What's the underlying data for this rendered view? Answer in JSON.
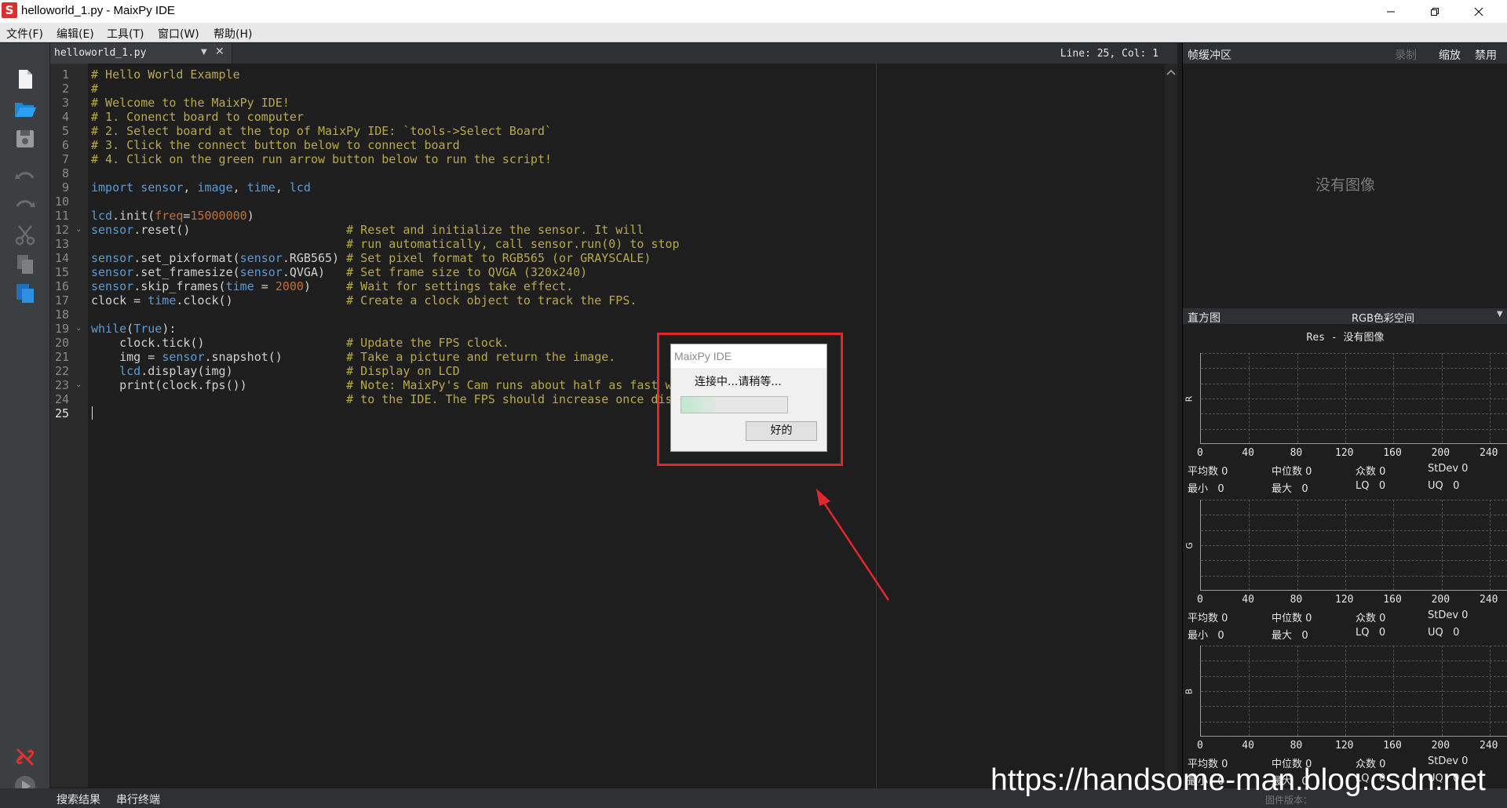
{
  "window": {
    "title": "helloworld_1.py - MaixPy IDE",
    "app_icon": "S"
  },
  "menu": [
    "文件(F)",
    "编辑(E)",
    "工具(T)",
    "窗口(W)",
    "帮助(H)"
  ],
  "editor": {
    "tab_name": "helloworld_1.py",
    "cursor_status": "Line: 25, Col: 1",
    "code_lines": [
      "# Hello World Example",
      "#",
      "# Welcome to the MaixPy IDE!",
      "# 1. Conenct board to computer",
      "# 2. Select board at the top of MaixPy IDE: `tools->Select Board`",
      "# 3. Click the connect button below to connect board",
      "# 4. Click on the green run arrow button below to run the script!",
      "",
      "import sensor, image, time, lcd",
      "",
      "lcd.init(freq=15000000)",
      "sensor.reset()                      # Reset and initialize the sensor. It will",
      "                                    # run automatically, call sensor.run(0) to stop",
      "sensor.set_pixformat(sensor.RGB565) # Set pixel format to RGB565 (or GRAYSCALE)",
      "sensor.set_framesize(sensor.QVGA)   # Set frame size to QVGA (320x240)",
      "sensor.skip_frames(time = 2000)     # Wait for settings take effect.",
      "clock = time.clock()                # Create a clock object to track the FPS.",
      "",
      "while(True):",
      "    clock.tick()                    # Update the FPS clock.",
      "    img = sensor.snapshot()         # Take a picture and return the image.",
      "    lcd.display(img)                # Display on LCD",
      "    print(clock.fps())              # Note: MaixPy's Cam runs about half as fast when connected",
      "                                    # to the IDE. The FPS should increase once disconnected.",
      ""
    ]
  },
  "framebuffer": {
    "title": "帧缓冲区",
    "record": "录制",
    "zoom": "缩放",
    "disable": "禁用",
    "no_image": "没有图像"
  },
  "histogram": {
    "title": "直方图",
    "color_space": "RGB色彩空间",
    "res_label": "Res - 没有图像",
    "x_ticks": [
      "0",
      "40",
      "80",
      "120",
      "160",
      "200",
      "240"
    ],
    "channels": [
      {
        "name": "R",
        "stats": {
          "mean": "平均数 0",
          "median": "中位数 0",
          "mode": "众数 0",
          "stdev": "StDev 0",
          "min": "最小   0",
          "max": "最大   0",
          "lq": "LQ   0",
          "uq": "UQ   0"
        }
      },
      {
        "name": "G",
        "stats": {
          "mean": "平均数 0",
          "median": "中位数 0",
          "mode": "众数 0",
          "stdev": "StDev 0",
          "min": "最小   0",
          "max": "最大   0",
          "lq": "LQ   0",
          "uq": "UQ   0"
        }
      },
      {
        "name": "B",
        "stats": {
          "mean": "平均数 0",
          "median": "中位数 0",
          "mode": "众数 0",
          "stdev": "StDev 0",
          "min": "最小   0",
          "max": "最大   0",
          "lq": "LQ   0",
          "uq": "UQ   0"
        }
      }
    ]
  },
  "bottom": {
    "search_results": "搜索结果",
    "serial_terminal": "串行终端",
    "firmware": "固件版本："
  },
  "dialog": {
    "title": "MaixPy IDE",
    "message": "连接中...请稍等...",
    "ok": "好的",
    "progress": 0.35
  },
  "watermark": "https://handsome-man.blog.csdn.net",
  "colors": {
    "accent_red": "#e0282c",
    "comment": "#b9a84a",
    "keyword": "#5b9bd5",
    "number": "#c06f3b"
  }
}
